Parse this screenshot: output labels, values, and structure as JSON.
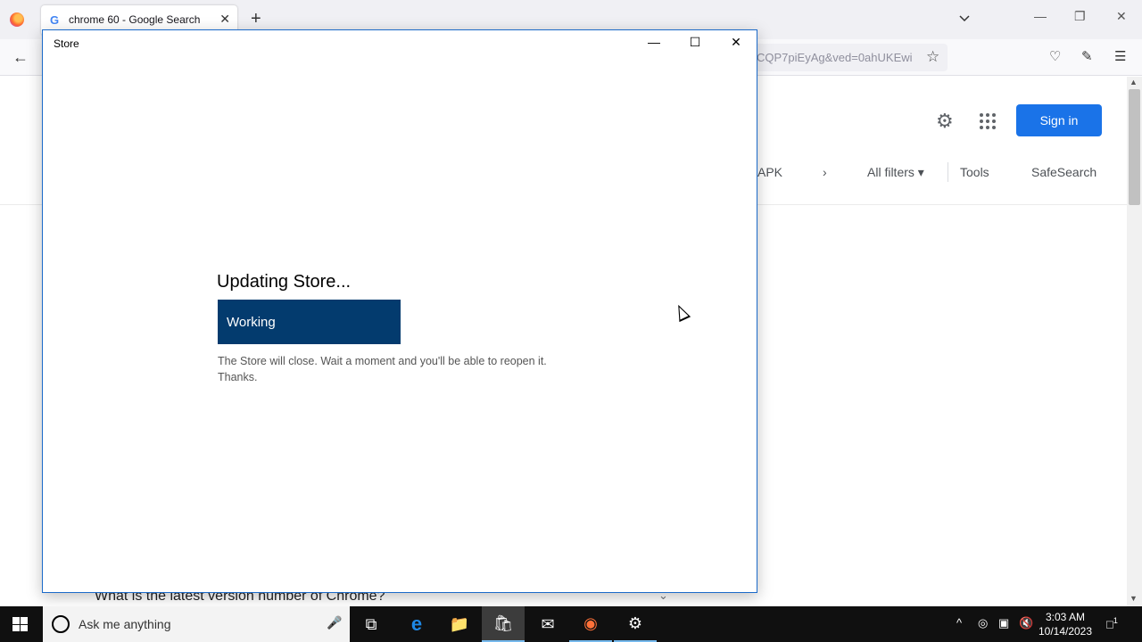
{
  "browser": {
    "tab_title": "chrome 60 - Google Search",
    "tab_favicon": "G",
    "url_text": "CQP7piEyAg&ved=0ahUKEwi",
    "new_tab_symbol": "+",
    "close_symbol": "✕"
  },
  "google": {
    "signin_label": "Sign in",
    "filters": {
      "apk": "APK",
      "all_filters": "All filters",
      "tools": "Tools",
      "safesearch": "SafeSearch"
    },
    "question": "What is the latest version number of Chrome?"
  },
  "store": {
    "window_title": "Store",
    "heading": "Updating Store...",
    "status_button": "Working",
    "message_line1": "The Store will close. Wait a moment and you'll be able to reopen it.",
    "message_line2": "Thanks.",
    "accent_color": "#033b6e"
  },
  "taskbar": {
    "search_placeholder": "Ask me anything",
    "time": "3:03 AM",
    "date": "10/14/2023",
    "notification_count": "1"
  }
}
